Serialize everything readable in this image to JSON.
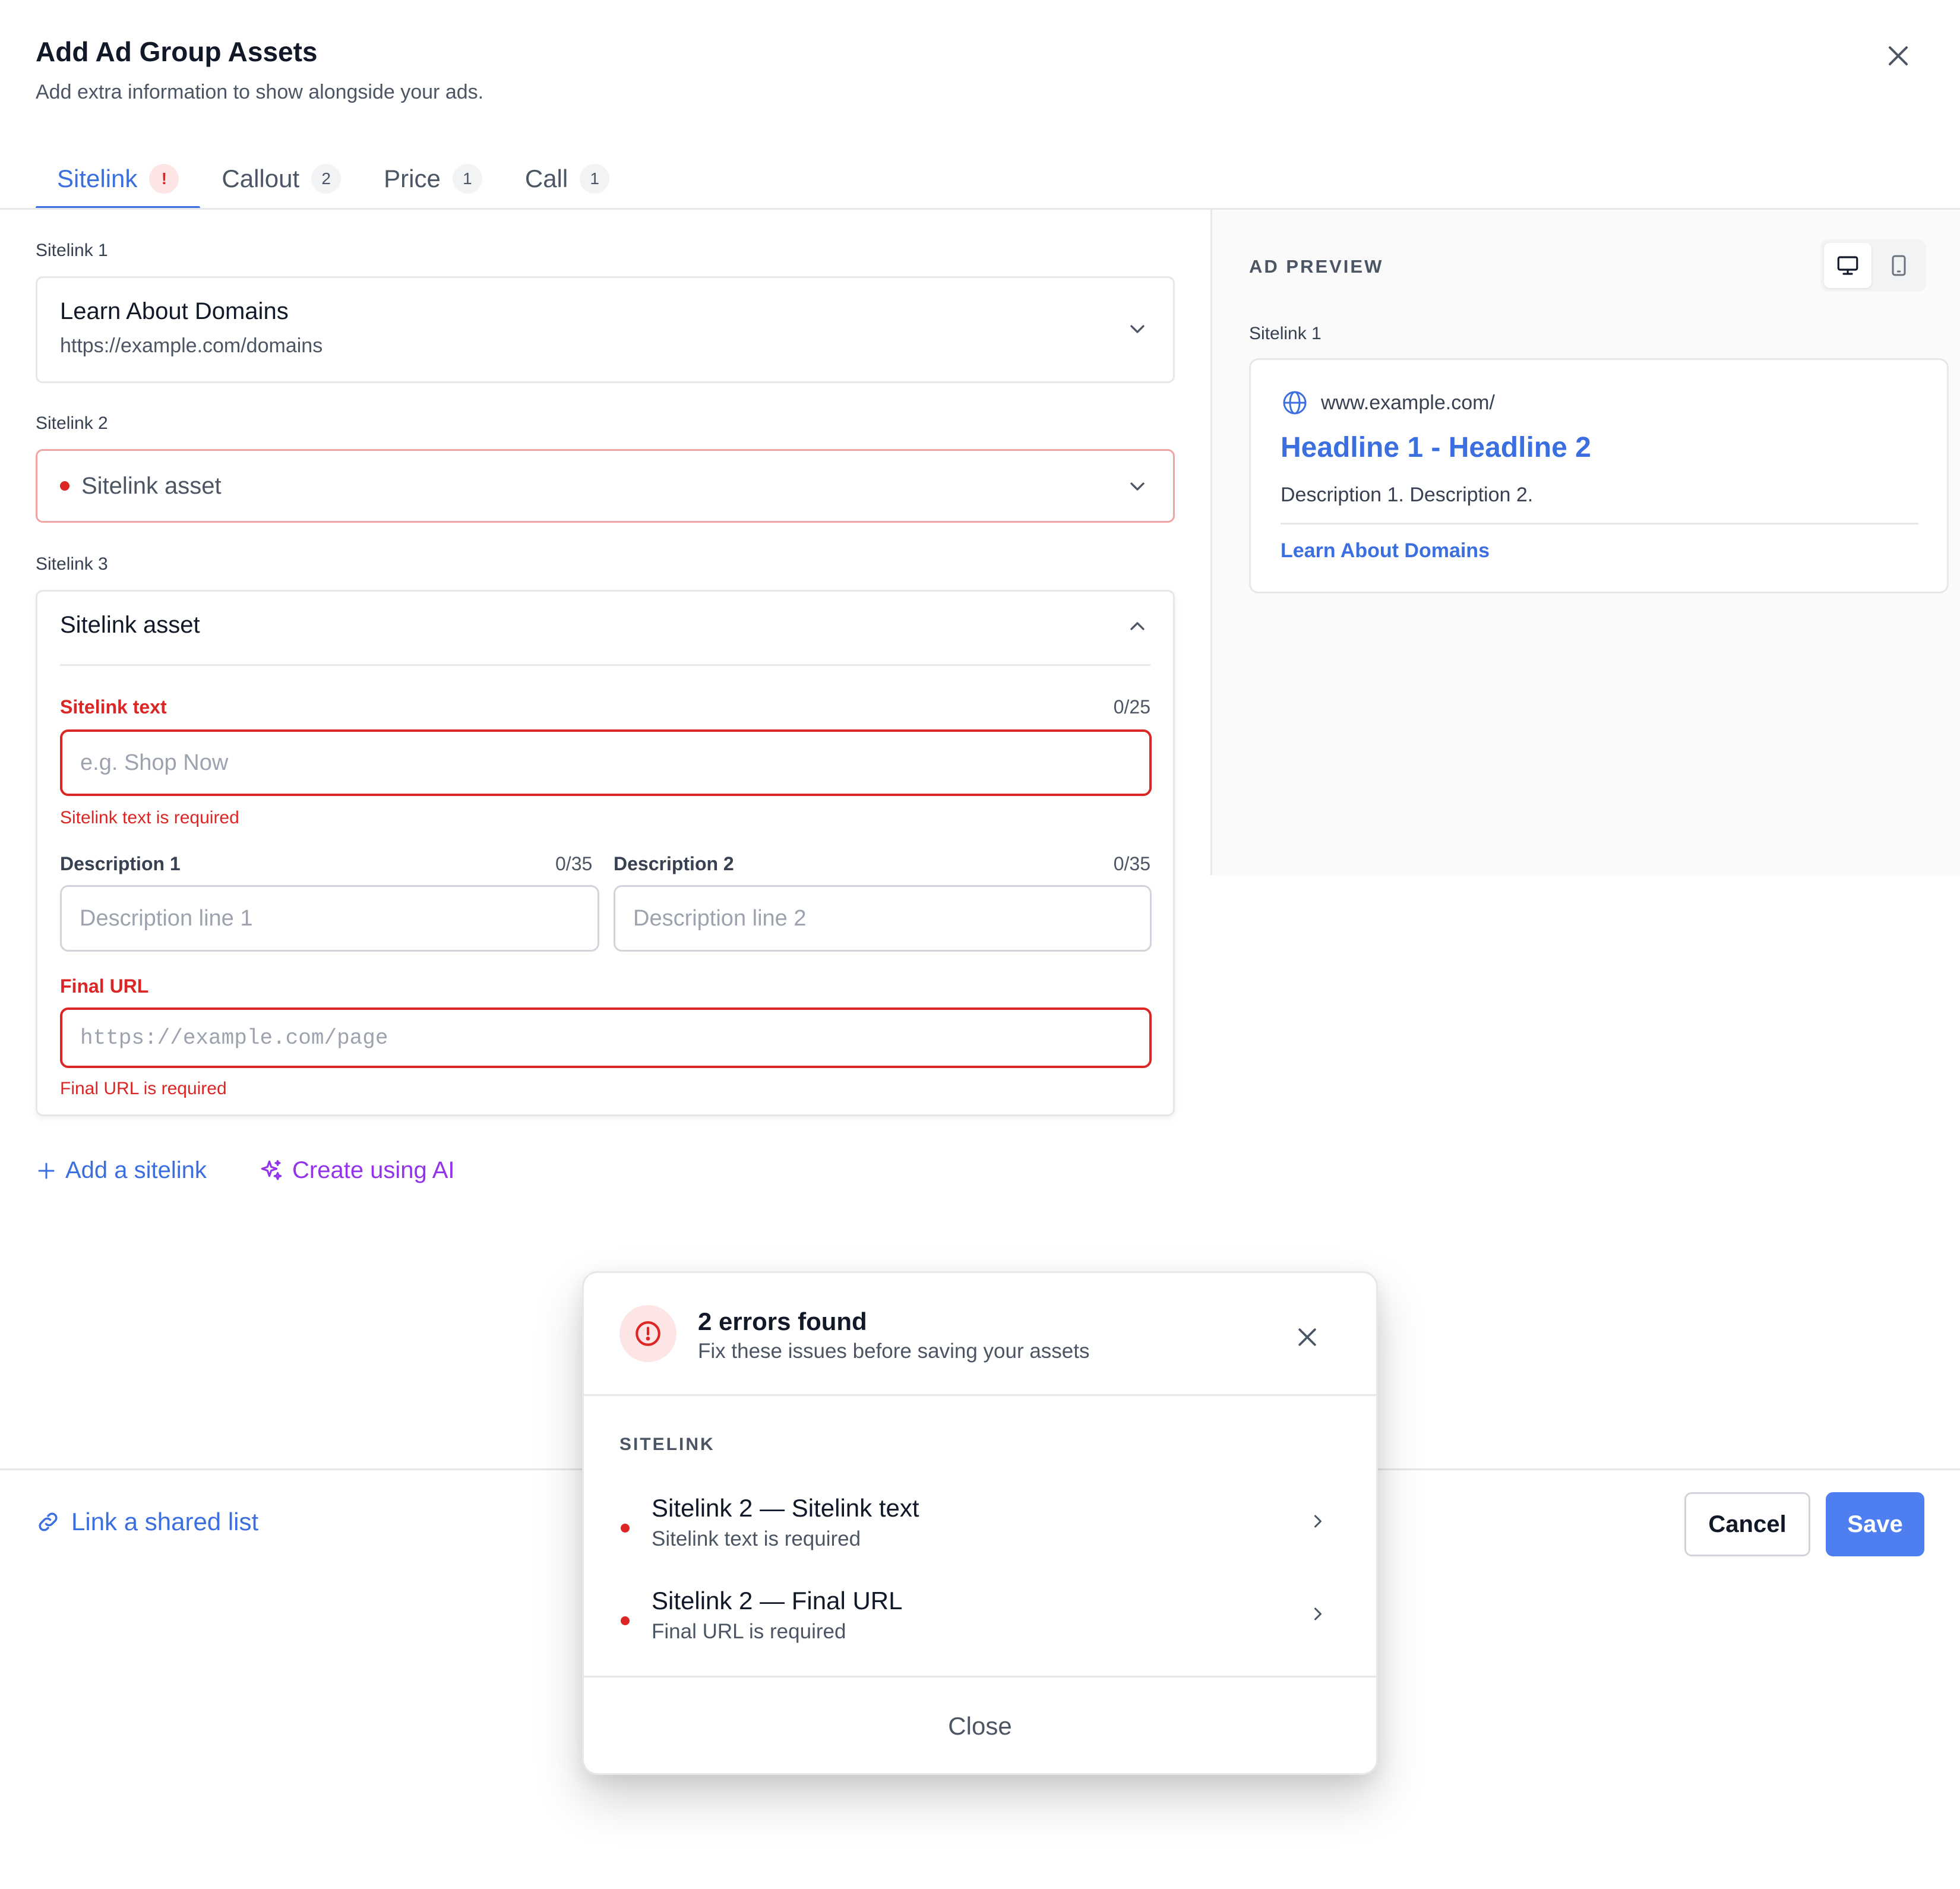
{
  "header": {
    "title": "Add Ad Group Assets",
    "subtitle": "Add extra information to show alongside your ads."
  },
  "tabs": [
    {
      "label": "Sitelink",
      "badge": "!",
      "active": true,
      "error": true
    },
    {
      "label": "Callout",
      "badge": "2"
    },
    {
      "label": "Price",
      "badge": "1"
    },
    {
      "label": "Call",
      "badge": "1"
    }
  ],
  "sitelinks": {
    "s1": {
      "label": "Sitelink 1",
      "title": "Learn About Domains",
      "url": "https://example.com/domains"
    },
    "s2": {
      "label": "Sitelink 2",
      "title": "Sitelink asset"
    },
    "s3": {
      "label": "Sitelink 3",
      "title": "Sitelink asset",
      "text_label": "Sitelink text",
      "text_counter": "0/25",
      "text_placeholder": "e.g. Shop Now",
      "text_error": "Sitelink text is required",
      "desc1_label": "Description 1",
      "desc1_counter": "0/35",
      "desc1_placeholder": "Description line 1",
      "desc2_label": "Description 2",
      "desc2_counter": "0/35",
      "desc2_placeholder": "Description line 2",
      "url_label": "Final URL",
      "url_placeholder": "https://example.com/page",
      "url_error": "Final URL is required"
    }
  },
  "actions": {
    "add_sitelink": "Add a sitelink",
    "create_ai": "Create using AI"
  },
  "preview": {
    "title": "AD PREVIEW",
    "label": "Sitelink 1",
    "url": "www.example.com/",
    "headline": "Headline 1 - Headline 2",
    "description": "Description 1. Description 2.",
    "link": "Learn About Domains"
  },
  "footer": {
    "link_shared": "Link a shared list",
    "cancel": "Cancel",
    "save": "Save"
  },
  "popup": {
    "title": "2 errors found",
    "subtitle": "Fix these issues before saving your assets",
    "section": "SITELINK",
    "errors": [
      {
        "title": "Sitelink 2 — Sitelink text",
        "message": "Sitelink text is required"
      },
      {
        "title": "Sitelink 2 — Final URL",
        "message": "Final URL is required"
      }
    ],
    "close": "Close"
  },
  "colors": {
    "accent": "#3b6fe0",
    "error": "#dc2626",
    "ai": "#9333ea",
    "save_button": "#4f7ef0"
  }
}
